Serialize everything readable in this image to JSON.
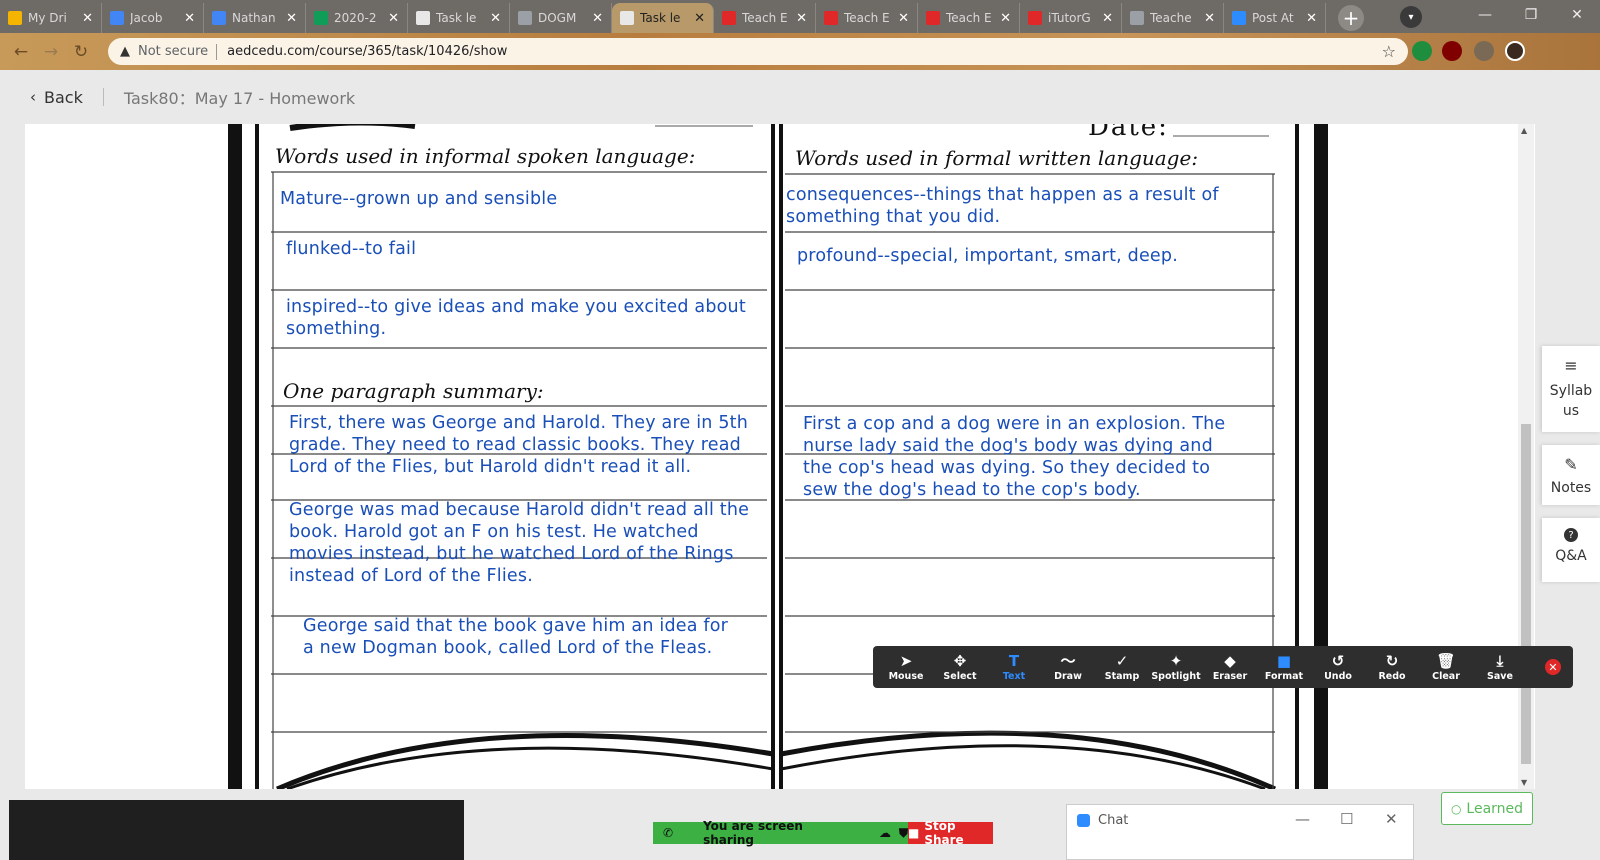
{
  "browser": {
    "tabs": [
      {
        "title": "My Dri",
        "color": "#f4b400"
      },
      {
        "title": "Jacob",
        "color": "#4285f4"
      },
      {
        "title": "Nathan",
        "color": "#4285f4"
      },
      {
        "title": "2020-2",
        "color": "#0f9d58"
      },
      {
        "title": "Task le",
        "color": "#e8e8e8"
      },
      {
        "title": "DOGM",
        "color": "#9aa0a6"
      },
      {
        "title": "Task le",
        "color": "#e8e8e8",
        "active": true
      },
      {
        "title": "Teach E",
        "color": "#e02828"
      },
      {
        "title": "Teach E",
        "color": "#e02828"
      },
      {
        "title": "Teach E",
        "color": "#e02828"
      },
      {
        "title": "iTutorG",
        "color": "#e02828"
      },
      {
        "title": "Teache",
        "color": "#9aa0a6"
      },
      {
        "title": "Post At",
        "color": "#2d8cff"
      }
    ],
    "security_label": "Not secure",
    "url": "aedcedu.com/course/365/task/10426/show"
  },
  "page": {
    "back_label": "Back",
    "task_title": "Task80：May 17 - Homework"
  },
  "worksheet": {
    "date_label": "Date:",
    "left_heading": "Words used in informal spoken language:",
    "right_heading": "Words used in formal written language:",
    "summary_heading": "One paragraph summary:",
    "left_entries": [
      "Mature--grown up and sensible",
      "flunked--to fail",
      "inspired--to give ideas and make you excited about something."
    ],
    "right_entries": [
      "consequences--things that happen as a result of something that you did.",
      "profound--special, important, smart, deep."
    ],
    "left_summary": [
      "First, there was George and Harold. They are in 5th grade. They need to read classic books. They read Lord of the Flies, but Harold didn't read it all.",
      "George was mad because Harold didn't read all the book. Harold got an F on his test. He watched movies instead, but he watched Lord of the Rings instead of Lord of the Flies.",
      "George said that the book gave him an idea for a new Dogman book, called Lord of the Fleas."
    ],
    "right_summary": [
      "First a cop and a dog were in an explosion.  The nurse lady said the dog's body was dying and the cop's head was dying.   So they decided to sew the dog's head to the cop's body."
    ]
  },
  "side_panel": {
    "syllabus": "Syllabus",
    "notes": "Notes",
    "qa": "Q&A"
  },
  "annotation_toolbar": {
    "tools": [
      {
        "label": "Mouse",
        "icon": "cursor-icon",
        "glyph": "➤"
      },
      {
        "label": "Select",
        "icon": "move-icon",
        "glyph": "✥"
      },
      {
        "label": "Text",
        "icon": "text-icon",
        "glyph": "T",
        "selected": true
      },
      {
        "label": "Draw",
        "icon": "draw-icon",
        "glyph": "〜"
      },
      {
        "label": "Stamp",
        "icon": "check-icon",
        "glyph": "✓"
      },
      {
        "label": "Spotlight",
        "icon": "spotlight-icon",
        "glyph": "✦"
      },
      {
        "label": "Eraser",
        "icon": "eraser-icon",
        "glyph": "◆"
      },
      {
        "label": "Format",
        "icon": "format-icon",
        "glyph": "■"
      },
      {
        "label": "Undo",
        "icon": "undo-icon",
        "glyph": "↺"
      },
      {
        "label": "Redo",
        "icon": "redo-icon",
        "glyph": "↻"
      },
      {
        "label": "Clear",
        "icon": "trash-icon",
        "glyph": "🗑"
      },
      {
        "label": "Save",
        "icon": "save-icon",
        "glyph": "⤓"
      }
    ]
  },
  "share_bar": {
    "message": "You are screen sharing",
    "stop_label": "Stop Share"
  },
  "chat": {
    "title": "Chat"
  },
  "learned_label": "Learned",
  "colors": {
    "handwriting_blue": "#1a4fb8",
    "zoom_blue": "#2d8cff",
    "learned_green": "#5cb85c",
    "stop_red": "#e02828"
  }
}
